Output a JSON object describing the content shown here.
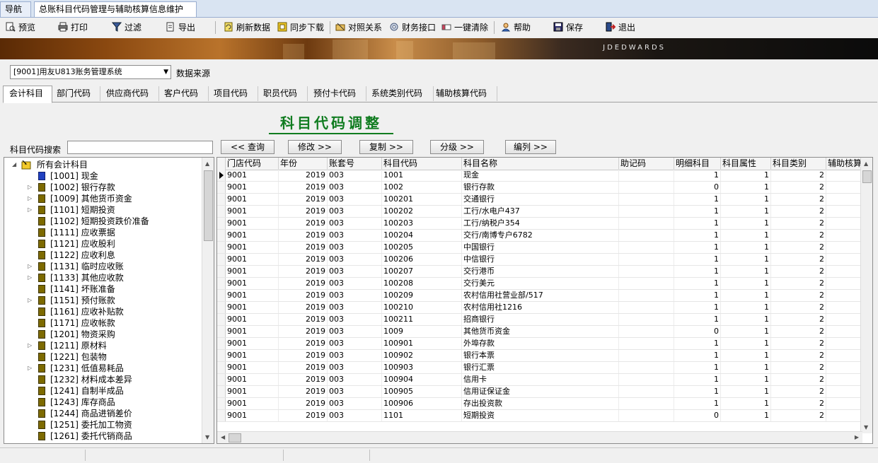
{
  "doc_tabs": [
    {
      "label": "导航",
      "active": false
    },
    {
      "label": "总账科目代码管理与辅助核算信息维护",
      "active": true
    }
  ],
  "toolbar": {
    "preview": "预览",
    "print": "打印",
    "filter": "过滤",
    "export": "导出",
    "refresh": "刷新数据",
    "sync": "同步下载",
    "mapping": "对照关系",
    "finance_api": "财务接口",
    "clear_all": "一键清除",
    "help": "帮助",
    "save": "保存",
    "exit": "退出"
  },
  "banner": {
    "brand": "JDEDWARDS"
  },
  "source": {
    "selected": "[9001]用友U813账务管理系统",
    "label": "数据来源"
  },
  "module_tabs": [
    "会计科目",
    "部门代码",
    "供应商代码",
    "客户代码",
    "项目代码",
    "职员代码",
    "预付卡代码",
    "系统类别代码",
    "辅助核算代码"
  ],
  "panel_title": "科目代码调整",
  "search": {
    "label": "科目代码搜索",
    "value": ""
  },
  "actions": {
    "query": "<< 查询",
    "modify": "修改 >>",
    "copy": "复制 >>",
    "grade": "分级 >>",
    "arrange": "编列 >>"
  },
  "tree": {
    "root": "所有会计科目",
    "items": [
      {
        "label": "[1001] 现金",
        "expandable": false,
        "icon": "blue"
      },
      {
        "label": "[1002] 银行存款",
        "expandable": true,
        "icon": "olive"
      },
      {
        "label": "[1009] 其他货币资金",
        "expandable": true,
        "icon": "olive"
      },
      {
        "label": "[1101] 短期投资",
        "expandable": true,
        "icon": "olive"
      },
      {
        "label": "[1102] 短期投资跌价准备",
        "expandable": false,
        "icon": "olive"
      },
      {
        "label": "[1111] 应收票据",
        "expandable": false,
        "icon": "olive"
      },
      {
        "label": "[1121] 应收股利",
        "expandable": false,
        "icon": "olive"
      },
      {
        "label": "[1122] 应收利息",
        "expandable": false,
        "icon": "olive"
      },
      {
        "label": "[1131] 临时应收账",
        "expandable": true,
        "icon": "olive"
      },
      {
        "label": "[1133] 其他应收款",
        "expandable": true,
        "icon": "olive"
      },
      {
        "label": "[1141] 坏账准备",
        "expandable": false,
        "icon": "olive"
      },
      {
        "label": "[1151] 预付账款",
        "expandable": true,
        "icon": "olive"
      },
      {
        "label": "[1161] 应收补贴款",
        "expandable": false,
        "icon": "olive"
      },
      {
        "label": "[1171] 应收帐款",
        "expandable": false,
        "icon": "olive"
      },
      {
        "label": "[1201] 物资采购",
        "expandable": false,
        "icon": "olive"
      },
      {
        "label": "[1211] 原材料",
        "expandable": true,
        "icon": "olive"
      },
      {
        "label": "[1221] 包装物",
        "expandable": false,
        "icon": "olive"
      },
      {
        "label": "[1231] 低值易耗品",
        "expandable": true,
        "icon": "olive"
      },
      {
        "label": "[1232] 材料成本差异",
        "expandable": false,
        "icon": "olive"
      },
      {
        "label": "[1241] 自制半成品",
        "expandable": false,
        "icon": "olive"
      },
      {
        "label": "[1243] 库存商品",
        "expandable": false,
        "icon": "olive"
      },
      {
        "label": "[1244] 商品进销差价",
        "expandable": false,
        "icon": "olive"
      },
      {
        "label": "[1251] 委托加工物资",
        "expandable": false,
        "icon": "olive"
      },
      {
        "label": "[1261] 委托代销商品",
        "expandable": false,
        "icon": "olive"
      }
    ]
  },
  "grid": {
    "columns": [
      "门店代码",
      "年份",
      "账套号",
      "科目代码",
      "科目名称",
      "助记码",
      "明细科目",
      "科目属性",
      "科目类别",
      "辅助核算"
    ],
    "rows": [
      [
        "9001",
        "2019",
        "003",
        "1001",
        "现金",
        "",
        "1",
        "1",
        "2"
      ],
      [
        "9001",
        "2019",
        "003",
        "1002",
        "银行存款",
        "",
        "0",
        "1",
        "2"
      ],
      [
        "9001",
        "2019",
        "003",
        "100201",
        "交通银行",
        "",
        "1",
        "1",
        "2"
      ],
      [
        "9001",
        "2019",
        "003",
        "100202",
        "工行/水电户437",
        "",
        "1",
        "1",
        "2"
      ],
      [
        "9001",
        "2019",
        "003",
        "100203",
        "工行/纳税户354",
        "",
        "1",
        "1",
        "2"
      ],
      [
        "9001",
        "2019",
        "003",
        "100204",
        "交行/南博专户6782",
        "",
        "1",
        "1",
        "2"
      ],
      [
        "9001",
        "2019",
        "003",
        "100205",
        "中国银行",
        "",
        "1",
        "1",
        "2"
      ],
      [
        "9001",
        "2019",
        "003",
        "100206",
        "中信银行",
        "",
        "1",
        "1",
        "2"
      ],
      [
        "9001",
        "2019",
        "003",
        "100207",
        "交行港币",
        "",
        "1",
        "1",
        "2"
      ],
      [
        "9001",
        "2019",
        "003",
        "100208",
        "交行美元",
        "",
        "1",
        "1",
        "2"
      ],
      [
        "9001",
        "2019",
        "003",
        "100209",
        "农村信用社营业部/517",
        "",
        "1",
        "1",
        "2"
      ],
      [
        "9001",
        "2019",
        "003",
        "100210",
        "农村信用社1216",
        "",
        "1",
        "1",
        "2"
      ],
      [
        "9001",
        "2019",
        "003",
        "100211",
        "招商银行",
        "",
        "1",
        "1",
        "2"
      ],
      [
        "9001",
        "2019",
        "003",
        "1009",
        "其他货币资金",
        "",
        "0",
        "1",
        "2"
      ],
      [
        "9001",
        "2019",
        "003",
        "100901",
        "外埠存款",
        "",
        "1",
        "1",
        "2"
      ],
      [
        "9001",
        "2019",
        "003",
        "100902",
        "银行本票",
        "",
        "1",
        "1",
        "2"
      ],
      [
        "9001",
        "2019",
        "003",
        "100903",
        "银行汇票",
        "",
        "1",
        "1",
        "2"
      ],
      [
        "9001",
        "2019",
        "003",
        "100904",
        "信用卡",
        "",
        "1",
        "1",
        "2"
      ],
      [
        "9001",
        "2019",
        "003",
        "100905",
        "信用证保证金",
        "",
        "1",
        "1",
        "2"
      ],
      [
        "9001",
        "2019",
        "003",
        "100906",
        "存出投资款",
        "",
        "1",
        "1",
        "2"
      ],
      [
        "9001",
        "2019",
        "003",
        "1101",
        "短期投资",
        "",
        "0",
        "1",
        "2"
      ]
    ]
  }
}
